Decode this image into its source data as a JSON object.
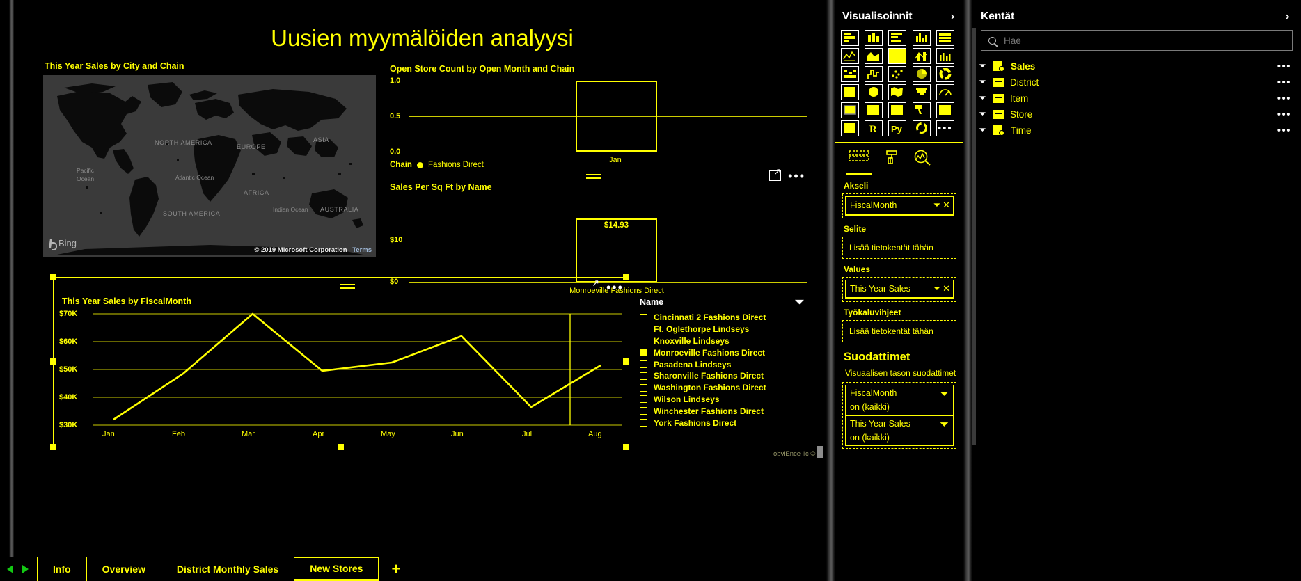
{
  "report": {
    "title": "Uusien myymälöiden analyysi"
  },
  "map_visual": {
    "title": "This Year Sales by City and Chain",
    "bing_label": "Bing",
    "copyright": "© 2019 Microsoft Corporation",
    "terms": "Terms",
    "continent_labels": [
      "NORTH AMERICA",
      "EUROPE",
      "ASIA",
      "AFRICA",
      "SOUTH AMERICA",
      "AUSTRALIA"
    ],
    "ocean_labels": [
      "Pacific Ocean",
      "Atlantic Ocean",
      "Indian Ocean"
    ]
  },
  "bar_visual": {
    "title": "Open Store Count by Open Month and Chain",
    "legend_label": "Chain",
    "legend_value": "Fashions Direct"
  },
  "sqft_visual": {
    "title": "Sales Per Sq Ft by Name",
    "focus_icon": "focus-mode-icon",
    "more_icon": "more-options-icon"
  },
  "line_visual": {
    "title": "This Year Sales by FiscalMonth",
    "focus_icon": "focus-mode-icon",
    "more_icon": "more-options-icon"
  },
  "legend": {
    "header": "Name",
    "items": [
      {
        "label": "Cincinnati 2 Fashions Direct",
        "selected": false
      },
      {
        "label": "Ft. Oglethorpe Lindseys",
        "selected": false
      },
      {
        "label": "Knoxville Lindseys",
        "selected": false
      },
      {
        "label": "Monroeville Fashions Direct",
        "selected": true
      },
      {
        "label": "Pasadena Lindseys",
        "selected": false
      },
      {
        "label": "Sharonville Fashions Direct",
        "selected": false
      },
      {
        "label": "Washington Fashions Direct",
        "selected": false
      },
      {
        "label": "Wilson Lindseys",
        "selected": false
      },
      {
        "label": "Winchester Fashions Direct",
        "selected": false
      },
      {
        "label": "York Fashions Direct",
        "selected": false
      }
    ],
    "collapse_icon": "chevron-down-icon"
  },
  "watermark": "obviEnce llc ©",
  "tabs": {
    "prev_icon": "prev-page-icon",
    "next_icon": "next-page-icon",
    "add_label": "+",
    "items": [
      {
        "label": "Info",
        "active": false
      },
      {
        "label": "Overview",
        "active": false
      },
      {
        "label": "District Monthly Sales",
        "active": false
      },
      {
        "label": "New Stores",
        "active": true
      }
    ]
  },
  "viz_pane": {
    "title": "Visualisoinnit",
    "expand_icon": "chevron-right-icon",
    "icons": [
      "stacked-bar-chart-icon",
      "stacked-column-chart-icon",
      "clustered-bar-chart-icon",
      "clustered-column-chart-icon",
      "hundred-percent-stacked-bar-icon",
      "line-chart-icon",
      "area-chart-icon",
      "stacked-area-chart-icon",
      "line-and-stacked-column-icon",
      "line-and-clustered-column-icon",
      "ribbon-chart-icon",
      "waterfall-chart-icon",
      "scatter-chart-icon",
      "pie-chart-icon",
      "donut-chart-icon",
      "treemap-icon",
      "map-icon",
      "filled-map-icon",
      "funnel-chart-icon",
      "gauge-icon",
      "card-icon",
      "multi-row-card-icon",
      "kpi-icon",
      "slicer-icon",
      "table-icon",
      "matrix-icon",
      "r-script-visual-icon",
      "python-visual-icon",
      "key-influencers-icon",
      "more-visuals-icon"
    ],
    "tabs": [
      {
        "name": "fields-tab-icon",
        "active": true
      },
      {
        "name": "format-paint-roller-icon",
        "active": false
      },
      {
        "name": "analytics-magnifier-icon",
        "active": false
      }
    ],
    "wells": [
      {
        "label": "Akseli",
        "chips": [
          {
            "value": "FiscalMonth",
            "dropdown_icon": "chevron-down-icon",
            "remove_icon": "close-icon"
          }
        ],
        "placeholder": null
      },
      {
        "label": "Selite",
        "chips": [],
        "placeholder": "Lisää tietokentät tähän"
      },
      {
        "label": "Values",
        "chips": [
          {
            "value": "This Year Sales",
            "dropdown_icon": "chevron-down-icon",
            "remove_icon": "close-icon"
          }
        ],
        "placeholder": null
      },
      {
        "label": "Työkaluvihjeet",
        "chips": [],
        "placeholder": "Lisää tietokentät tähän"
      }
    ],
    "filters": {
      "title": "Suodattimet",
      "subtitle": "Visuaalisen tason suodattimet",
      "items": [
        {
          "name": "FiscalMonth",
          "state": "on (kaikki)",
          "icon": "chevron-down-icon"
        },
        {
          "name": "This Year Sales",
          "state": "on (kaikki)",
          "icon": "chevron-down-icon"
        }
      ]
    }
  },
  "fields_pane": {
    "title": "Kentät",
    "expand_icon": "chevron-right-icon",
    "search_placeholder": "Hae",
    "search_value": "",
    "search_icon": "search-icon",
    "items": [
      {
        "label": "Sales",
        "icon": "measure-table-icon",
        "caret": "chevron-down-icon",
        "more": "more-options-icon",
        "bold": true
      },
      {
        "label": "District",
        "icon": "table-icon",
        "caret": "chevron-down-icon",
        "more": "more-options-icon",
        "bold": false
      },
      {
        "label": "Item",
        "icon": "table-icon",
        "caret": "chevron-down-icon",
        "more": "more-options-icon",
        "bold": false
      },
      {
        "label": "Store",
        "icon": "table-icon",
        "caret": "chevron-down-icon",
        "more": "more-options-icon",
        "bold": false
      },
      {
        "label": "Time",
        "icon": "measure-table-icon",
        "caret": "chevron-down-icon",
        "more": "more-options-icon",
        "bold": false
      }
    ]
  },
  "chart_data": [
    {
      "type": "bar",
      "title": "Open Store Count by Open Month and Chain",
      "categories": [
        "Jan"
      ],
      "values": [
        1
      ],
      "series": [
        {
          "name": "Fashions Direct",
          "values": [
            1
          ]
        }
      ],
      "xlabel": "",
      "ylabel": "",
      "ylim": [
        0,
        1.0
      ],
      "yticks": [
        "0.0",
        "0.5",
        "1.0"
      ],
      "grid": true,
      "legend_position": "bottom"
    },
    {
      "type": "bar",
      "title": "Sales Per Sq Ft by Name",
      "categories": [
        "Monroeville Fashions Direct"
      ],
      "values": [
        14.93
      ],
      "data_labels": [
        "$14.93"
      ],
      "xlabel": "",
      "ylabel": "",
      "ylim": [
        0,
        15
      ],
      "yticks": [
        "$0",
        "$10"
      ],
      "grid": true,
      "legend_position": "none"
    },
    {
      "type": "line",
      "title": "This Year Sales by FiscalMonth",
      "categories": [
        "Jan",
        "Feb",
        "Mar",
        "Apr",
        "May",
        "Jun",
        "Jul",
        "Aug"
      ],
      "series": [
        {
          "name": "This Year Sales",
          "values": [
            32000,
            48500,
            69500,
            49500,
            52500,
            61000,
            38500,
            52000
          ]
        }
      ],
      "xlabel": "",
      "ylabel": "",
      "ylim": [
        30000,
        70000
      ],
      "yticks": [
        "$30K",
        "$40K",
        "$50K",
        "$60K",
        "$70K"
      ],
      "grid": true,
      "legend_position": "right"
    }
  ]
}
